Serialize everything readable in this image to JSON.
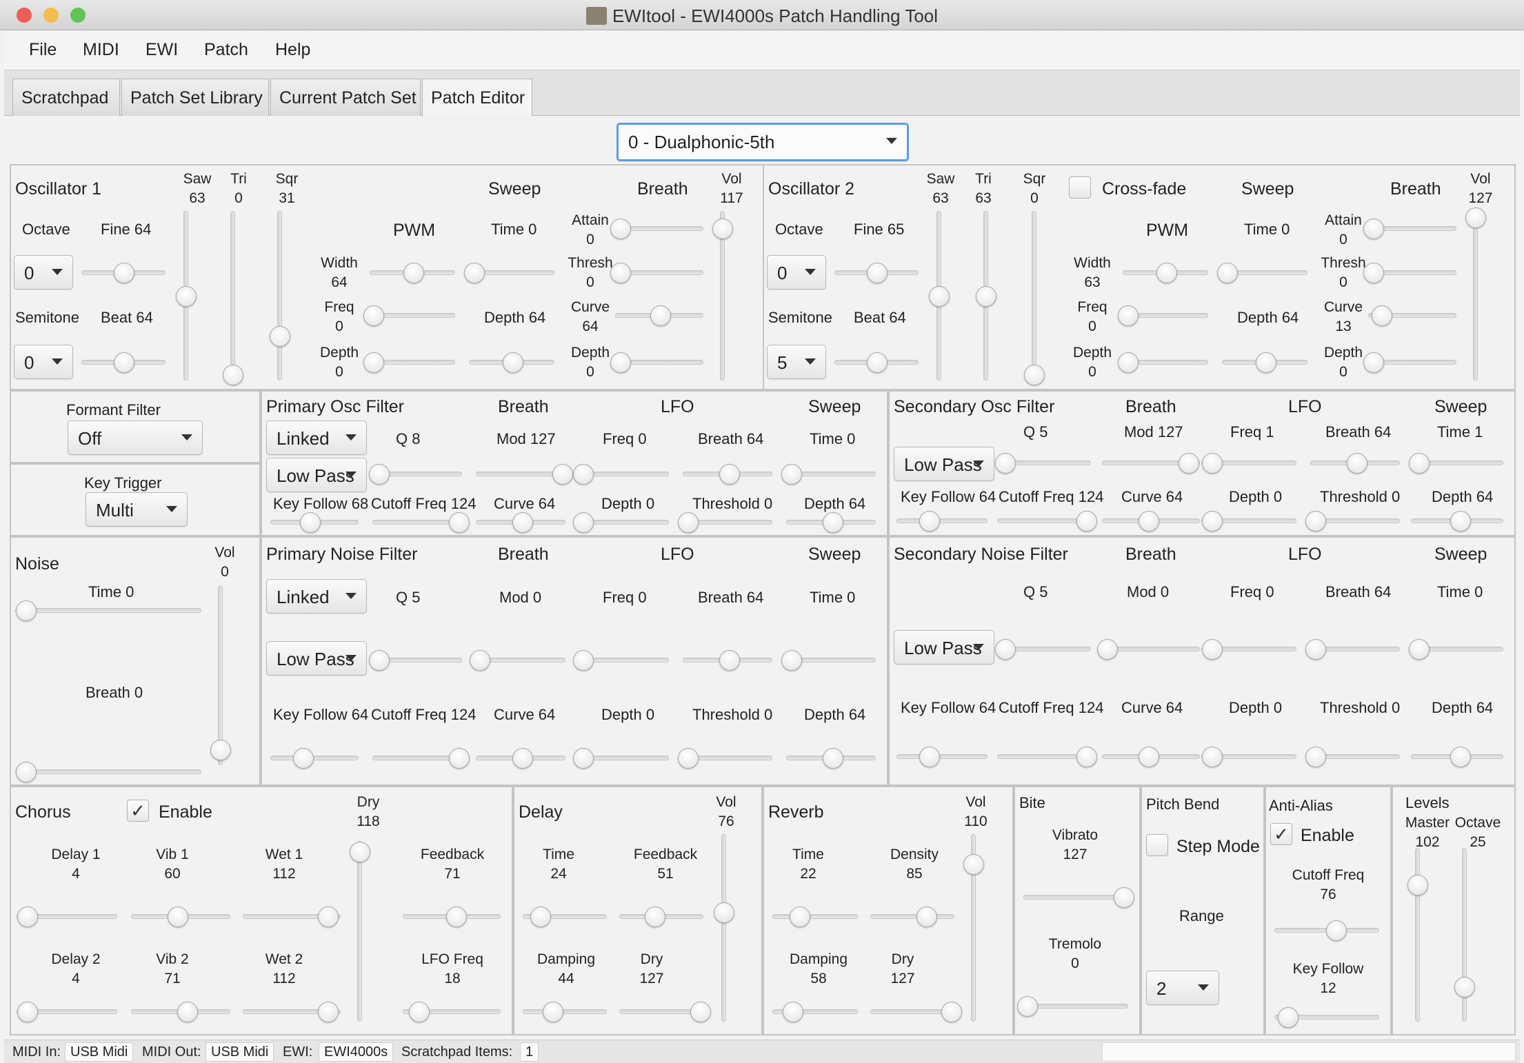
{
  "window": {
    "title": "EWItool - EWI4000s Patch Handling Tool",
    "colors": {
      "close": "#ed5e57",
      "minimize": "#f4bd4f",
      "zoom": "#61c454"
    }
  },
  "menu": [
    "File",
    "MIDI",
    "EWI",
    "Patch",
    "Help"
  ],
  "tabs": [
    "Scratchpad",
    "Patch Set Library",
    "Current Patch Set",
    "Patch Editor"
  ],
  "patch_select": "0 - Dualphonic-5th",
  "osc1": {
    "title": "Oscillator 1",
    "saw": "Saw",
    "saw_v": "63",
    "tri": "Tri",
    "tri_v": "0",
    "sqr": "Sqr",
    "sqr_v": "31",
    "octave": "Octave",
    "octave_v": "0",
    "fine": "Fine 64",
    "semitone": "Semitone",
    "semitone_v": "0",
    "beat": "Beat 64",
    "sweep": "Sweep",
    "breath": "Breath",
    "vol": "Vol",
    "vol_v": "117",
    "pwm": "PWM",
    "width": "Width",
    "width_v": "64",
    "freq": "Freq",
    "freq_v": "0",
    "depth": "Depth",
    "depth_v": "0",
    "time": "Time 0",
    "sdepth": "Depth 64",
    "attain": "Attain",
    "attain_v": "0",
    "thresh": "Thresh",
    "thresh_v": "0",
    "curve": "Curve",
    "curve_v": "64",
    "bdepth": "Depth",
    "bdepth_v": "0"
  },
  "osc2": {
    "title": "Oscillator 2",
    "saw": "Saw",
    "saw_v": "63",
    "tri": "Tri",
    "tri_v": "63",
    "sqr": "Sqr",
    "sqr_v": "0",
    "crossfade": "Cross-fade",
    "octave": "Octave",
    "octave_v": "0",
    "fine": "Fine 65",
    "semitone": "Semitone",
    "semitone_v": "5",
    "beat": "Beat 64",
    "sweep": "Sweep",
    "breath": "Breath",
    "vol": "Vol",
    "vol_v": "127",
    "pwm": "PWM",
    "width": "Width",
    "width_v": "63",
    "freq": "Freq",
    "freq_v": "0",
    "depth": "Depth",
    "depth_v": "0",
    "time": "Time 0",
    "sdepth": "Depth 64",
    "attain": "Attain",
    "attain_v": "0",
    "thresh": "Thresh",
    "thresh_v": "0",
    "curve": "Curve",
    "curve_v": "13",
    "bdepth": "Depth",
    "bdepth_v": "0"
  },
  "formant": {
    "title": "Formant Filter",
    "value": "Off"
  },
  "keytrigger": {
    "title": "Key Trigger",
    "value": "Multi"
  },
  "pof": {
    "title": "Primary Osc Filter",
    "breath": "Breath",
    "lfo": "LFO",
    "sweep": "Sweep",
    "mode": "Linked",
    "type": "Low Pass",
    "q": "Q 8",
    "mod": "Mod 127",
    "freq": "Freq 0",
    "lbreath": "Breath 64",
    "time": "Time 0",
    "keyfollow": "Key Follow 68",
    "cutoff": "Cutoff Freq 124",
    "curve": "Curve 64",
    "depth": "Depth 0",
    "threshold": "Threshold 0",
    "sdepth": "Depth 64"
  },
  "sof": {
    "title": "Secondary Osc Filter",
    "breath": "Breath",
    "lfo": "LFO",
    "sweep": "Sweep",
    "type": "Low Pass",
    "q": "Q 5",
    "mod": "Mod 127",
    "freq": "Freq 1",
    "lbreath": "Breath 64",
    "time": "Time 1",
    "keyfollow": "Key Follow 64",
    "cutoff": "Cutoff Freq 124",
    "curve": "Curve 64",
    "depth": "Depth 0",
    "threshold": "Threshold 0",
    "sdepth": "Depth 64"
  },
  "noise": {
    "title": "Noise",
    "vol": "Vol",
    "vol_v": "0",
    "time": "Time 0",
    "breath": "Breath 0"
  },
  "pnf": {
    "title": "Primary Noise Filter",
    "breath": "Breath",
    "lfo": "LFO",
    "sweep": "Sweep",
    "mode": "Linked",
    "type": "Low Pass",
    "q": "Q 5",
    "mod": "Mod 0",
    "freq": "Freq 0",
    "lbreath": "Breath 64",
    "time": "Time 0",
    "keyfollow": "Key Follow 64",
    "cutoff": "Cutoff Freq 124",
    "curve": "Curve 64",
    "depth": "Depth 0",
    "threshold": "Threshold 0",
    "sdepth": "Depth 64"
  },
  "snf": {
    "title": "Secondary Noise Filter",
    "breath": "Breath",
    "lfo": "LFO",
    "sweep": "Sweep",
    "type": "Low Pass",
    "q": "Q 5",
    "mod": "Mod 0",
    "freq": "Freq 0",
    "lbreath": "Breath 64",
    "time": "Time 0",
    "keyfollow": "Key Follow 64",
    "cutoff": "Cutoff Freq 124",
    "curve": "Curve 64",
    "depth": "Depth 0",
    "threshold": "Threshold 0",
    "sdepth": "Depth 64"
  },
  "chorus": {
    "title": "Chorus",
    "enable": "Enable",
    "enabled": true,
    "dry": "Dry",
    "dry_v": "118",
    "delay1": "Delay 1",
    "delay1_v": "4",
    "vib1": "Vib 1",
    "vib1_v": "60",
    "wet1": "Wet 1",
    "wet1_v": "112",
    "feedback": "Feedback",
    "feedback_v": "71",
    "delay2": "Delay 2",
    "delay2_v": "4",
    "vib2": "Vib 2",
    "vib2_v": "71",
    "wet2": "Wet 2",
    "wet2_v": "112",
    "lfofreq": "LFO Freq",
    "lfofreq_v": "18"
  },
  "delay": {
    "title": "Delay",
    "vol": "Vol",
    "vol_v": "76",
    "time": "Time",
    "time_v": "24",
    "feedback": "Feedback",
    "feedback_v": "51",
    "damping": "Damping",
    "damping_v": "44",
    "dry": "Dry",
    "dry_v": "127"
  },
  "reverb": {
    "title": "Reverb",
    "vol": "Vol",
    "vol_v": "110",
    "time": "Time",
    "time_v": "22",
    "density": "Density",
    "density_v": "85",
    "damping": "Damping",
    "damping_v": "58",
    "dry": "Dry",
    "dry_v": "127"
  },
  "bite": {
    "title": "Bite",
    "vibrato": "Vibrato",
    "vibrato_v": "127",
    "tremolo": "Tremolo",
    "tremolo_v": "0"
  },
  "pitchbend": {
    "title": "Pitch Bend",
    "stepmode": "Step Mode",
    "range": "Range",
    "range_v": "2"
  },
  "antialias": {
    "title": "Anti-Alias",
    "enable": "Enable",
    "enabled": true,
    "cutoff": "Cutoff Freq",
    "cutoff_v": "76",
    "keyfollow": "Key Follow",
    "keyfollow_v": "12"
  },
  "levels": {
    "title": "Levels",
    "master": "Master",
    "master_v": "102",
    "octave": "Octave",
    "octave_v": "25"
  },
  "status": {
    "midi_in_label": "MIDI In:",
    "midi_in": "USB Midi",
    "midi_out_label": "MIDI Out:",
    "midi_out": "USB Midi",
    "ewi_label": "EWI:",
    "ewi": "EWI4000s",
    "scratch_label": "Scratchpad Items:",
    "scratch": "1"
  }
}
